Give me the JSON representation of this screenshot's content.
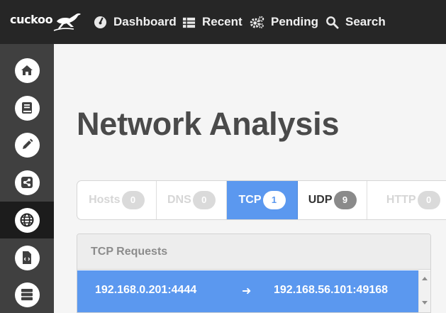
{
  "topbar": {
    "logo_text": "cuckoo",
    "nav": [
      {
        "label": "Dashboard",
        "icon": "dashboard-icon"
      },
      {
        "label": "Recent",
        "icon": "list-icon"
      },
      {
        "label": "Pending",
        "icon": "gears-icon"
      },
      {
        "label": "Search",
        "icon": "search-icon"
      }
    ]
  },
  "sidebar": {
    "items": [
      {
        "icon": "home-icon",
        "active": false
      },
      {
        "icon": "book-icon",
        "active": false
      },
      {
        "icon": "pencil-icon",
        "active": false
      },
      {
        "icon": "share-icon",
        "active": false
      },
      {
        "icon": "globe-icon",
        "active": true
      },
      {
        "icon": "code-file-icon",
        "active": false
      },
      {
        "icon": "server-icon",
        "active": false
      }
    ]
  },
  "main": {
    "title": "Network Analysis",
    "tabs": [
      {
        "label": "Hosts",
        "count": "0",
        "state": "disabled"
      },
      {
        "label": "DNS",
        "count": "0",
        "state": "disabled"
      },
      {
        "label": "TCP",
        "count": "1",
        "state": "active"
      },
      {
        "label": "UDP",
        "count": "9",
        "state": "normal"
      },
      {
        "label": "HTTP",
        "count": "0",
        "state": "disabled"
      }
    ],
    "panel": {
      "title": "TCP Requests",
      "rows": [
        {
          "source": "192.168.0.201:4444",
          "arrow": "➜",
          "destination": "192.168.56.101:49168"
        }
      ]
    }
  },
  "colors": {
    "accent": "#5b98ef",
    "topbar": "#262626",
    "sidebar": "#404040",
    "sidebar_active": "#1c1c1c"
  }
}
